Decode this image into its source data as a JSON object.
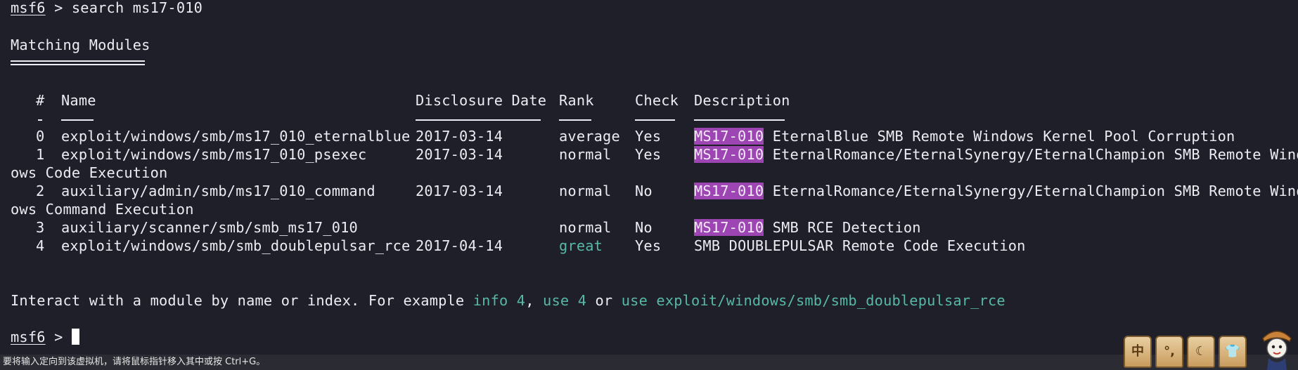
{
  "terminal": {
    "prompt_label": "msf6",
    "prompt_sep": " > ",
    "command": "search ms17-010",
    "heading": "Matching Modules",
    "columns": {
      "num": "#",
      "name": "Name",
      "date": "Disclosure Date",
      "rank": "Rank",
      "check": "Check",
      "desc": "Description"
    },
    "rows": [
      {
        "num": "0",
        "name": "exploit/windows/smb/ms17_010_eternalblue",
        "date": "2017-03-14",
        "rank": "average",
        "check": "Yes",
        "tag": "MS17-010",
        "desc": " EternalBlue SMB Remote Windows Kernel Pool Corruption",
        "wrap": ""
      },
      {
        "num": "1",
        "name": "exploit/windows/smb/ms17_010_psexec",
        "date": "2017-03-14",
        "rank": "normal",
        "check": "Yes",
        "tag": "MS17-010",
        "desc": " EternalRomance/EternalSynergy/EternalChampion SMB Remote Wind",
        "wrap": "ows Code Execution"
      },
      {
        "num": "2",
        "name": "auxiliary/admin/smb/ms17_010_command",
        "date": "2017-03-14",
        "rank": "normal",
        "check": "No",
        "tag": "MS17-010",
        "desc": " EternalRomance/EternalSynergy/EternalChampion SMB Remote Wind",
        "wrap": "ows Command Execution"
      },
      {
        "num": "3",
        "name": "auxiliary/scanner/smb/smb_ms17_010",
        "date": "",
        "rank": "normal",
        "check": "No",
        "tag": "MS17-010",
        "desc": " SMB RCE Detection",
        "wrap": ""
      },
      {
        "num": "4",
        "name": "exploit/windows/smb/smb_doublepulsar_rce",
        "date": "2017-04-14",
        "rank": "great",
        "check": "Yes",
        "tag": "",
        "desc": "SMB DOUBLEPULSAR Remote Code Execution",
        "wrap": ""
      }
    ],
    "interact": {
      "prefix": "Interact with a module by name or index. For example ",
      "cmd1": "info 4",
      "sep1": ", ",
      "cmd2": "use 4",
      "sep2": " or ",
      "cmd3": "use exploit/windows/smb/smb_doublepulsar_rce"
    },
    "prompt2_label": "msf6",
    "prompt2_sep": " > "
  },
  "statusbar": {
    "text": "要将输入定向到该虚拟机，请将鼠标指针移入其中或按 Ctrl+G。"
  },
  "dock": {
    "icons": [
      {
        "name": "chinese-input-icon",
        "glyph": "中"
      },
      {
        "name": "punctuation-icon",
        "glyph": "°,"
      },
      {
        "name": "moon-icon",
        "glyph": "☾"
      },
      {
        "name": "shirt-icon",
        "glyph": "👕"
      }
    ],
    "mascot": "mascot-icon"
  },
  "colors": {
    "background": "#1e1f29",
    "foreground": "#ecedf2",
    "green": "#57b8a6",
    "highlight": "#9c45b3"
  }
}
